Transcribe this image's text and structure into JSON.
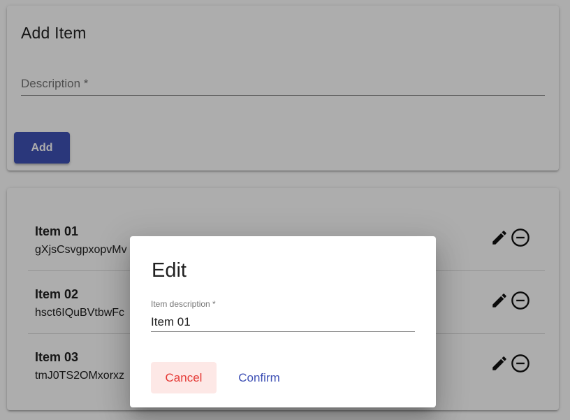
{
  "add_card": {
    "title": "Add Item",
    "description_placeholder": "Description *",
    "add_label": "Add"
  },
  "items": [
    {
      "title": "Item 01",
      "description": "gXjsCsvgpxopvMv"
    },
    {
      "title": "Item 02",
      "description": "hsct6IQuBVtbwFc"
    },
    {
      "title": "Item 03",
      "description": "tmJ0TS2OMxorxz"
    }
  ],
  "icons": {
    "edit": "pencil-icon",
    "remove": "minus-circle-icon"
  },
  "dialog": {
    "title": "Edit",
    "field_label": "Item description *",
    "field_value": "Item 01",
    "cancel_label": "Cancel",
    "confirm_label": "Confirm"
  },
  "colors": {
    "primary": "#3f51b5",
    "warn": "#e53935",
    "warn_bg": "#fde8e6"
  }
}
